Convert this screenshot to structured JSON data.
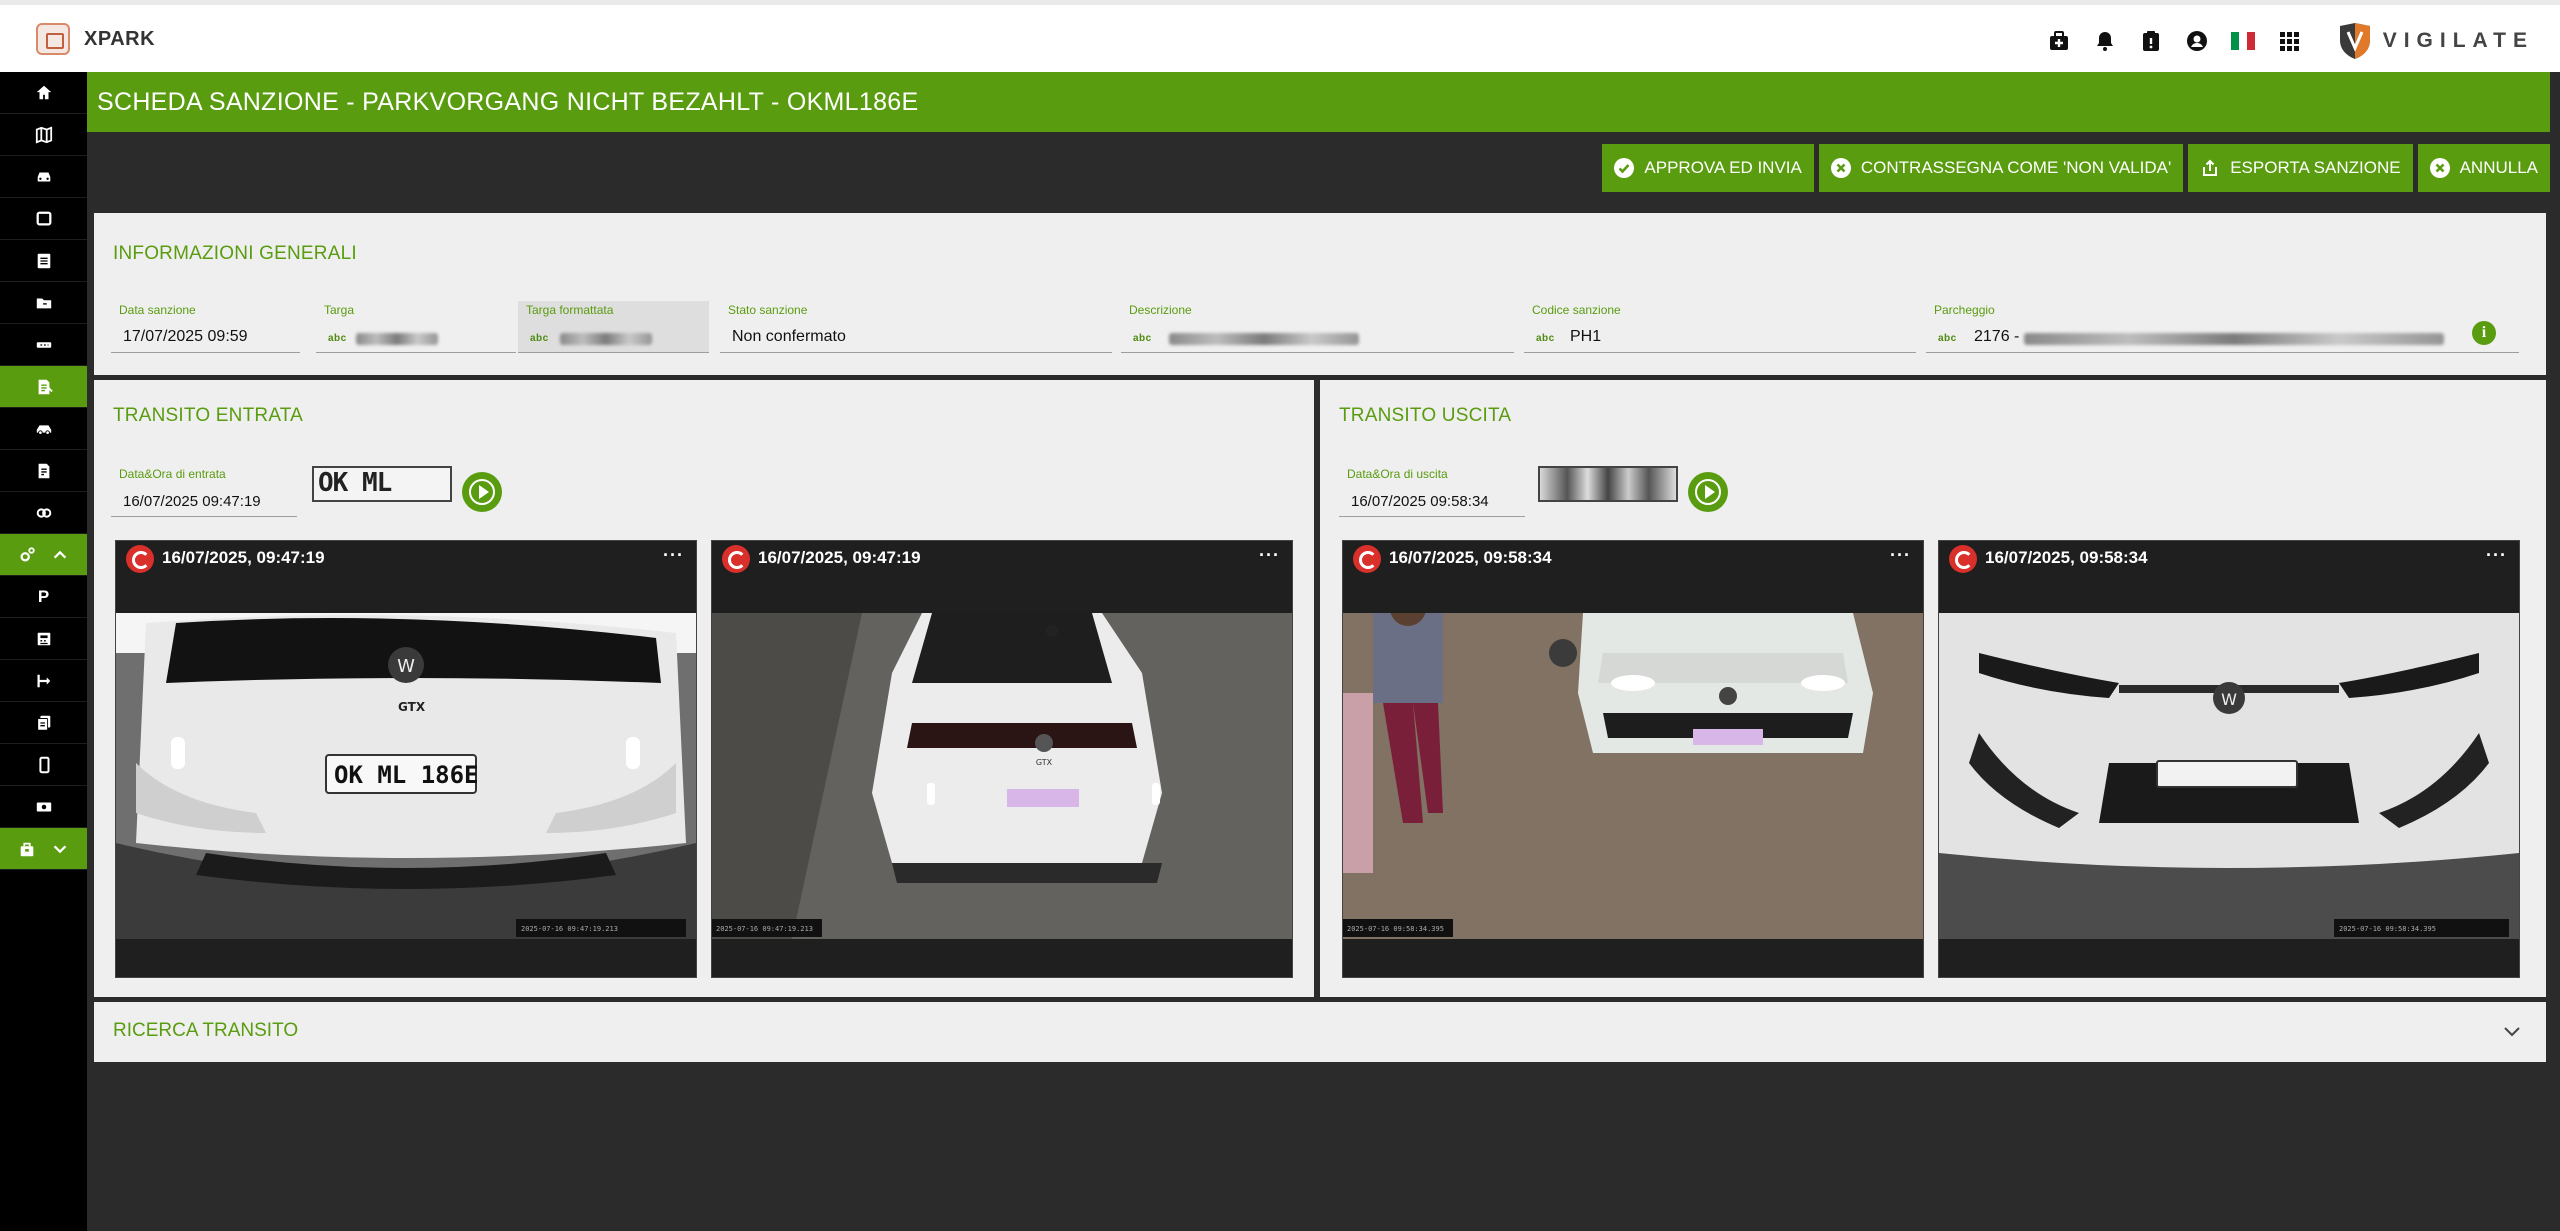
{
  "app": {
    "name": "XPARK",
    "vendor": "VIGILATE"
  },
  "topbar": {
    "icons": [
      "medkit-icon",
      "bell-icon",
      "clipboard-icon",
      "user-circle-icon",
      "italy-flag-icon",
      "apps-grid-icon"
    ],
    "flag_colors": [
      "#009246",
      "#ffffff",
      "#ce2b37"
    ]
  },
  "sidebar": {
    "items": [
      {
        "icon": "home-icon"
      },
      {
        "icon": "map-icon"
      },
      {
        "icon": "car-icon"
      },
      {
        "icon": "monitor-icon"
      },
      {
        "icon": "list-icon"
      },
      {
        "icon": "folder-icon"
      },
      {
        "icon": "ticket-icon"
      },
      {
        "icon": "document-edit-icon",
        "active": true
      },
      {
        "icon": "vehicle-icon"
      },
      {
        "icon": "receipt-icon"
      },
      {
        "icon": "link-icon"
      },
      {
        "icon": "settings-icon",
        "group": true,
        "chevron": "chevron-up-icon"
      },
      {
        "icon": "parking-icon",
        "label": "P"
      },
      {
        "icon": "cash-register-icon"
      },
      {
        "icon": "route-icon"
      },
      {
        "icon": "file-copy-icon"
      },
      {
        "icon": "mobile-icon"
      },
      {
        "icon": "money-icon"
      },
      {
        "icon": "bag-icon",
        "group": true,
        "chevron": "chevron-down-icon",
        "active": true
      }
    ]
  },
  "header": {
    "title": "SCHEDA SANZIONE - PARKVORGANG NICHT BEZAHLT - OKML186E"
  },
  "actions": [
    {
      "label": "APPROVA ED INVIA",
      "icon": "check-circle-icon"
    },
    {
      "label": "CONTRASSEGNA COME 'NON VALIDA'",
      "icon": "x-circle-icon"
    },
    {
      "label": "ESPORTA SANZIONE",
      "icon": "export-icon"
    },
    {
      "label": "ANNULLA",
      "icon": "x-circle-icon"
    }
  ],
  "general": {
    "title": "INFORMAZIONI GENERALI",
    "fields": {
      "data_sanzione": {
        "label": "Data sanzione",
        "value": "17/07/2025 09:59"
      },
      "targa": {
        "label": "Targa",
        "prefix": "abc"
      },
      "targa_formattata": {
        "label": "Targa formattata",
        "prefix": "abc"
      },
      "stato_sanzione": {
        "label": "Stato sanzione",
        "value": "Non confermato"
      },
      "descrizione": {
        "label": "Descrizione",
        "prefix": "abc"
      },
      "codice_sanzione": {
        "label": "Codice sanzione",
        "prefix": "abc",
        "value": "PH1"
      },
      "parcheggio": {
        "label": "Parcheggio",
        "prefix": "abc",
        "value": "2176 -"
      }
    },
    "info_glyph": "i"
  },
  "entry": {
    "title": "TRANSITO ENTRATA",
    "datetime_label": "Data&Ora di entrata",
    "datetime_value": "16/07/2025 09:47:19",
    "plate_text": "OK ML 186E",
    "cameras": [
      {
        "time": "16/07/2025, 09:47:19",
        "menu": "···",
        "plate_text": "OK ML 186E",
        "stamp": "2025-07-16 09:47:19.213"
      },
      {
        "time": "16/07/2025, 09:47:19",
        "menu": "···",
        "stamp": "2025-07-16 09:47:19.213"
      }
    ]
  },
  "exit": {
    "title": "TRANSITO USCITA",
    "datetime_label": "Data&Ora di uscita",
    "datetime_value": "16/07/2025 09:58:34",
    "cameras": [
      {
        "time": "16/07/2025, 09:58:34",
        "menu": "···",
        "stamp": "2025-07-16 09:58:34.395"
      },
      {
        "time": "16/07/2025, 09:58:34",
        "menu": "···",
        "stamp": "2025-07-16 09:58:34.395"
      }
    ]
  },
  "search": {
    "title": "RICERCA TRANSITO"
  },
  "colors": {
    "accent": "#5a9c0f",
    "background": "#2b2b2b",
    "panel": "#efefef",
    "sidebar": "#000000"
  }
}
